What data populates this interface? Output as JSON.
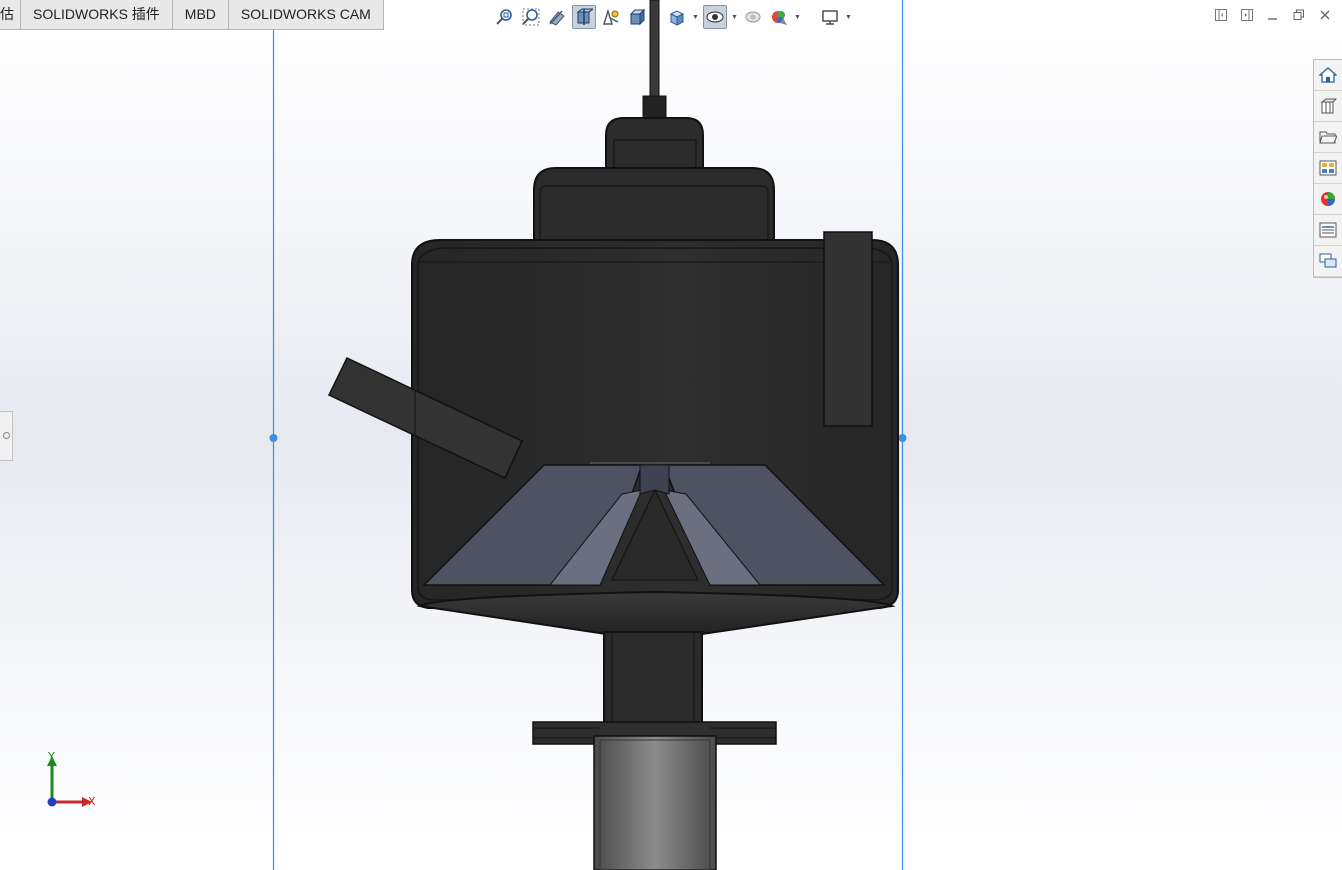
{
  "command_tabs": [
    {
      "label": "估",
      "partial": true
    },
    {
      "label": "SOLIDWORKS 插件"
    },
    {
      "label": "MBD"
    },
    {
      "label": "SOLIDWORKS CAM"
    }
  ],
  "heads_up_toolbar": [
    "zoom-to-fit-icon",
    "zoom-to-area-icon",
    "previous-view-icon",
    "section-view-icon",
    "dynamic-annotation-views-icon",
    "view-orientation-icon",
    "display-style-icon",
    "hide-show-items-icon",
    "edit-appearance-icon",
    "apply-scene-icon",
    "view-settings-icon"
  ],
  "window_controls": [
    "tile-left-icon",
    "tile-right-icon",
    "minimize-icon",
    "restore-icon",
    "close-icon"
  ],
  "task_pane": [
    "solidworks-resources-icon",
    "design-library-icon",
    "file-explorer-icon",
    "view-palette-icon",
    "appearances-scenes-icon",
    "custom-properties-icon",
    "forum-icon"
  ],
  "triad": {
    "x_label": "X",
    "y_label": "Y"
  },
  "colors": {
    "body": "#2b2b2b",
    "outline": "#111111",
    "section_faces": "#4e5261",
    "pipe": "#6b6b6b",
    "plane_lines": "#3b8fe0"
  }
}
